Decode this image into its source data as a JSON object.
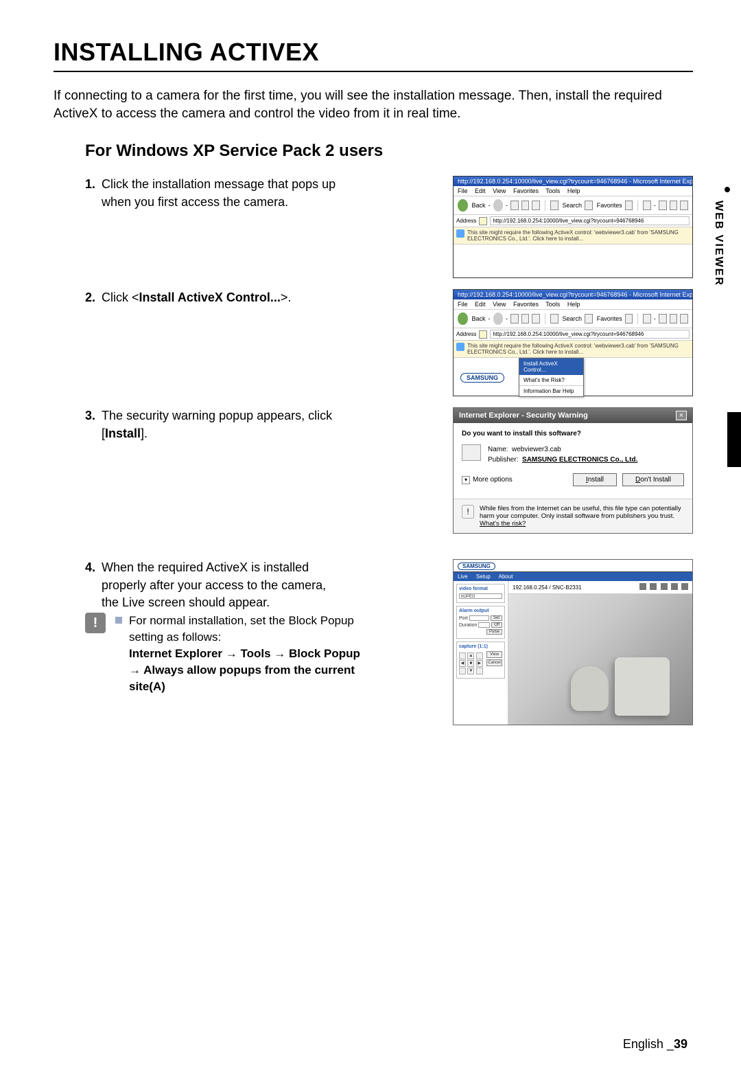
{
  "title": "INSTALLING ACTIVEX",
  "intro": "If connecting to a camera for the first time, you will see the installation message. Then, install the required ActiveX to access the camera and control the video from it in real time.",
  "subtitle": "For Windows XP Service Pack 2 users",
  "sideTab": "WEB VIEWER",
  "steps": {
    "s1": {
      "num": "1.",
      "text": "Click the installation message that pops up when you first access the camera."
    },
    "s2": {
      "num": "2.",
      "text_pre": "Click <",
      "text_bold": "Install ActiveX Control...",
      "text_post": ">."
    },
    "s3": {
      "num": "3.",
      "text_pre": "The security warning popup appears, click [",
      "text_bold": "Install",
      "text_post": "]."
    },
    "s4": {
      "num": "4.",
      "text": "When the required ActiveX is installed properly after your access to the camera, the Live screen should appear."
    }
  },
  "note": {
    "line1": "For normal installation, set the Block Popup setting as follows:",
    "path": "Internet Explorer → Tools → Block Popup → Always allow popups from the current site(A)"
  },
  "ie": {
    "winTitle": "http://192.168.0.254:10000/live_view.cgi?trycount=946768946 - Microsoft Internet Explorer",
    "menu": {
      "file": "File",
      "edit": "Edit",
      "view": "View",
      "fav": "Favorites",
      "tools": "Tools",
      "help": "Help"
    },
    "toolbar": {
      "back": "Back",
      "search": "Search",
      "fav": "Favorites"
    },
    "addrLabel": "Address",
    "addrUrl1": "http://192.168.0.254:10000/live_view.cgi?trycount=946768946",
    "addrUrl2": "http://192.168.0.254:10000/live_view.cgi?trycount=946768946",
    "infobar": "This site might require the following ActiveX control: 'webviewer3.cab' from 'SAMSUNG ELECTRONICS Co., Ltd.'. Click here to install...",
    "ctx": {
      "install": "Install ActiveX Control...",
      "risk": "What's the Risk?",
      "info": "Information Bar Help"
    },
    "samsung": "SAMSUNG"
  },
  "sec": {
    "title": "Internet Explorer - Security Warning",
    "question": "Do you want to install this software?",
    "nameLabel": "Name:",
    "nameValue": "webviewer3.cab",
    "pubLabel": "Publisher:",
    "pubValue": "SAMSUNG ELECTRONICS Co., Ltd.",
    "more": "More options",
    "install": "Install",
    "dont": "Don't Install",
    "footer_a": "While files from the Internet can be useful, this file type can potentially harm your computer. Only install software from publishers you trust. ",
    "footer_link": "What's the risk?"
  },
  "live": {
    "logo": "SAMSUNG",
    "tabs": {
      "live": "Live",
      "setup": "Setup",
      "about": "About"
    },
    "bar_ip": "192.168.0.254 / SNC-B2331",
    "side": {
      "vf_title": "video format",
      "vf_val": "MJPEG",
      "ac_title": "Alarm output",
      "port": "Port",
      "set": "Set",
      "duration": "Duration",
      "off": "Off",
      "pulse": "Pulse",
      "cap_title": "capture (1:1)",
      "view": "View",
      "cancel": "Cancel"
    }
  },
  "footer": {
    "lang": "English _",
    "page": "39"
  }
}
